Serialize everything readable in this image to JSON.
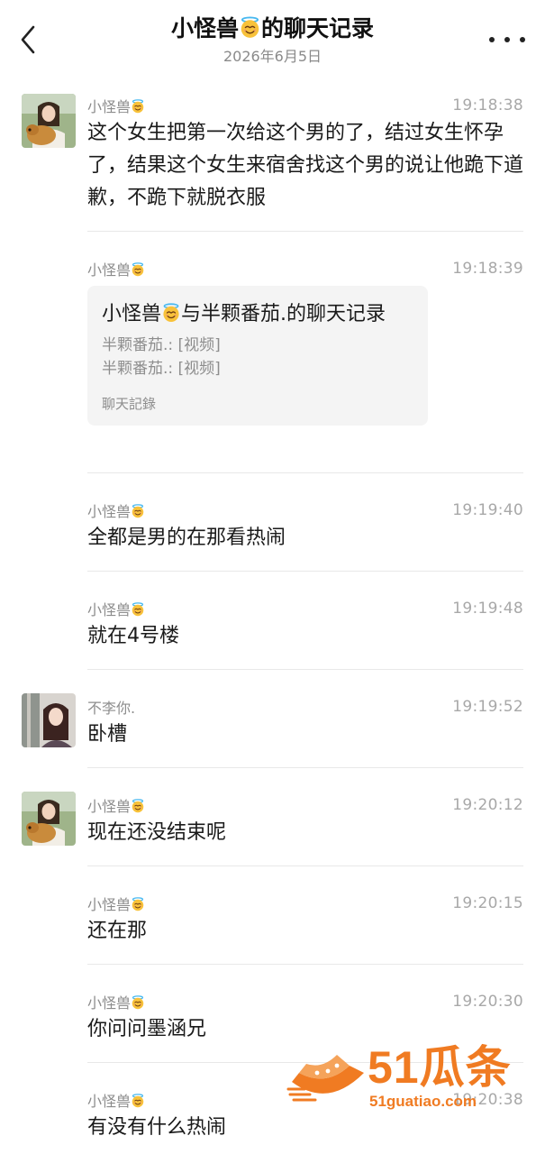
{
  "header": {
    "title": "小怪兽",
    "title_suffix": "的聊天记录",
    "date": "2026年6月5日"
  },
  "icons": {
    "back": "chevron-left-icon",
    "more": "more-dots-icon",
    "halo_emoji": "smiling-face-with-halo-emoji"
  },
  "messages": [
    {
      "sender": "小怪兽",
      "time": "19:18:38",
      "text": "这个女生把第一次给这个男的了，结过女生怀孕了，结果这个女生来宿舍找这个男的说让他跪下道歉，不跪下就脱衣服",
      "avatar": "girl-with-dog"
    },
    {
      "sender": "小怪兽",
      "time": "19:18:39",
      "record": {
        "title_a": "小怪兽",
        "title_b": "与半颗番茄.的聊天记录",
        "lines": [
          "半颗番茄.: [视频]",
          "半颗番茄.: [视频]"
        ],
        "footer": "聊天記錄"
      }
    },
    {
      "sender": "小怪兽",
      "time": "19:19:40",
      "text": "全都是男的在那看热闹"
    },
    {
      "sender": "小怪兽",
      "time": "19:19:48",
      "text": "就在4号楼"
    },
    {
      "sender": "不李你.",
      "time": "19:19:52",
      "text": "卧槽",
      "avatar": "girl-portrait"
    },
    {
      "sender": "小怪兽",
      "time": "19:20:12",
      "text": "现在还没结束呢",
      "avatar": "girl-with-dog"
    },
    {
      "sender": "小怪兽",
      "time": "19:20:15",
      "text": "还在那"
    },
    {
      "sender": "小怪兽",
      "time": "19:20:30",
      "text": "你问问墨涵兄"
    },
    {
      "sender": "小怪兽",
      "time": "19:20:38",
      "text": "有没有什么热闹"
    }
  ],
  "watermark": {
    "brand": "51瓜条",
    "url": "51guatiao.com",
    "color": "#f07b22"
  }
}
